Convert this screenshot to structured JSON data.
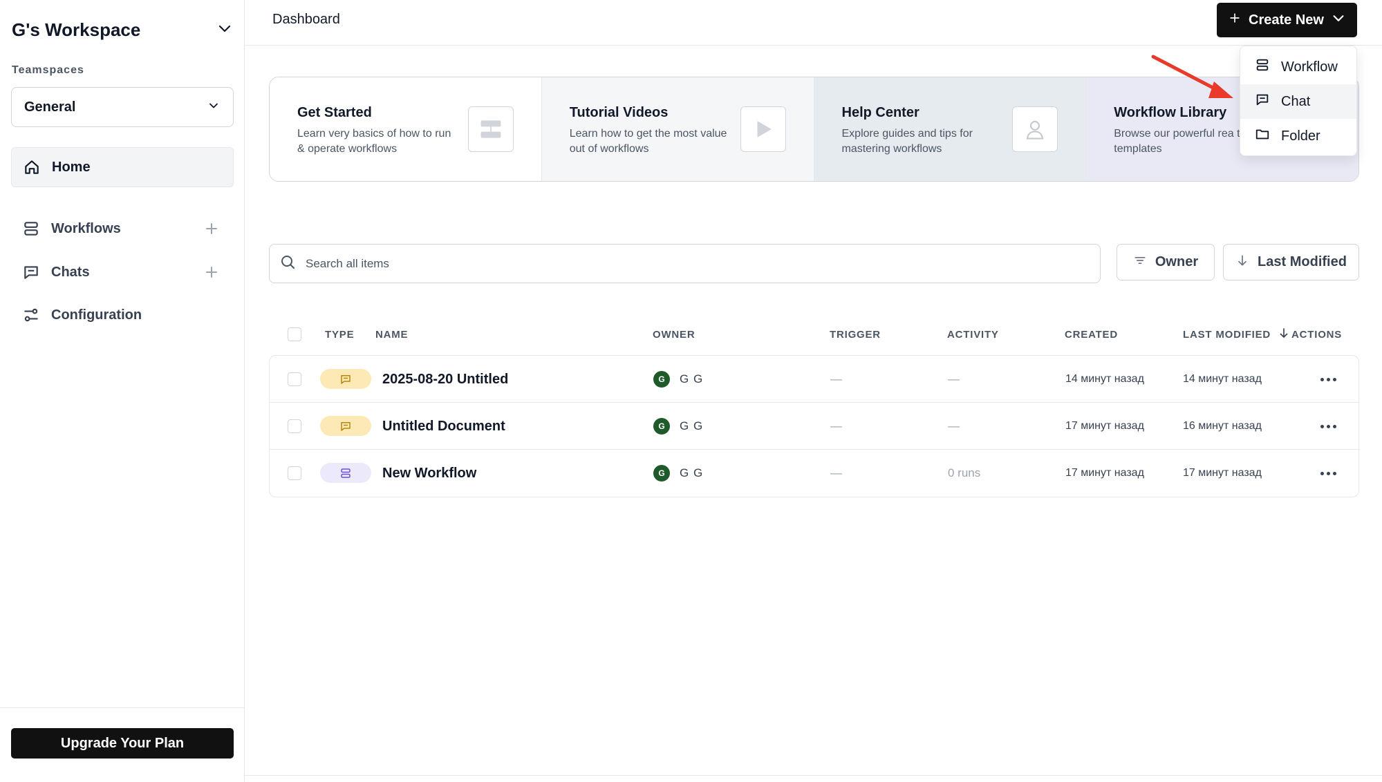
{
  "sidebar": {
    "workspace_name": "G's Workspace",
    "teamspaces_label": "Teamspaces",
    "teamspace_selected": "General",
    "nav": {
      "home": "Home",
      "workflows": "Workflows",
      "chats": "Chats",
      "configuration": "Configuration"
    },
    "upgrade_label": "Upgrade Your Plan"
  },
  "header": {
    "title": "Dashboard",
    "create_label": "Create New"
  },
  "create_menu": {
    "items": [
      {
        "label": "Workflow",
        "icon": "workflow-icon"
      },
      {
        "label": "Chat",
        "icon": "chat-icon",
        "active": true
      },
      {
        "label": "Folder",
        "icon": "folder-icon"
      }
    ]
  },
  "cards": [
    {
      "title": "Get Started",
      "description": "Learn very basics of how to run & operate workflows",
      "icon": "workflow-icon"
    },
    {
      "title": "Tutorial Videos",
      "description": "Learn how to get the most value out of workflows",
      "icon": "play-icon"
    },
    {
      "title": "Help Center",
      "description": "Explore guides and tips for mastering workflows",
      "icon": "person-icon"
    },
    {
      "title": "Workflow Library",
      "description": "Browse our powerful rea to-go templates",
      "icon": "library-icon"
    }
  ],
  "search": {
    "placeholder": "Search all items"
  },
  "filters": {
    "owner_label": "Owner",
    "sort_label": "Last Modified"
  },
  "table": {
    "columns": {
      "type": "TYPE",
      "name": "NAME",
      "owner": "OWNER",
      "trigger": "TRIGGER",
      "activity": "ACTIVITY",
      "created": "CREATED",
      "last_modified": "LAST MODIFIED",
      "actions": "ACTIONS"
    },
    "rows": [
      {
        "type": "chat",
        "name": "2025-08-20 Untitled",
        "owner_initial": "G",
        "owner_name": "G G",
        "trigger": "—",
        "activity": "—",
        "created": "14 минут назад",
        "last_modified": "14 минут назад"
      },
      {
        "type": "chat",
        "name": "Untitled Document",
        "owner_initial": "G",
        "owner_name": "G G",
        "trigger": "—",
        "activity": "—",
        "created": "17 минут назад",
        "last_modified": "16 минут назад"
      },
      {
        "type": "workflow",
        "name": "New Workflow",
        "owner_initial": "G",
        "owner_name": "G G",
        "trigger": "—",
        "activity": "0 runs",
        "created": "17 минут назад",
        "last_modified": "17 минут назад"
      }
    ]
  },
  "colors": {
    "primary_button": "#111111",
    "chat_pill": "#fde9b6",
    "workflow_pill": "#ece9fb",
    "avatar": "#1f5a2a",
    "annotation_arrow": "#e8392a"
  }
}
